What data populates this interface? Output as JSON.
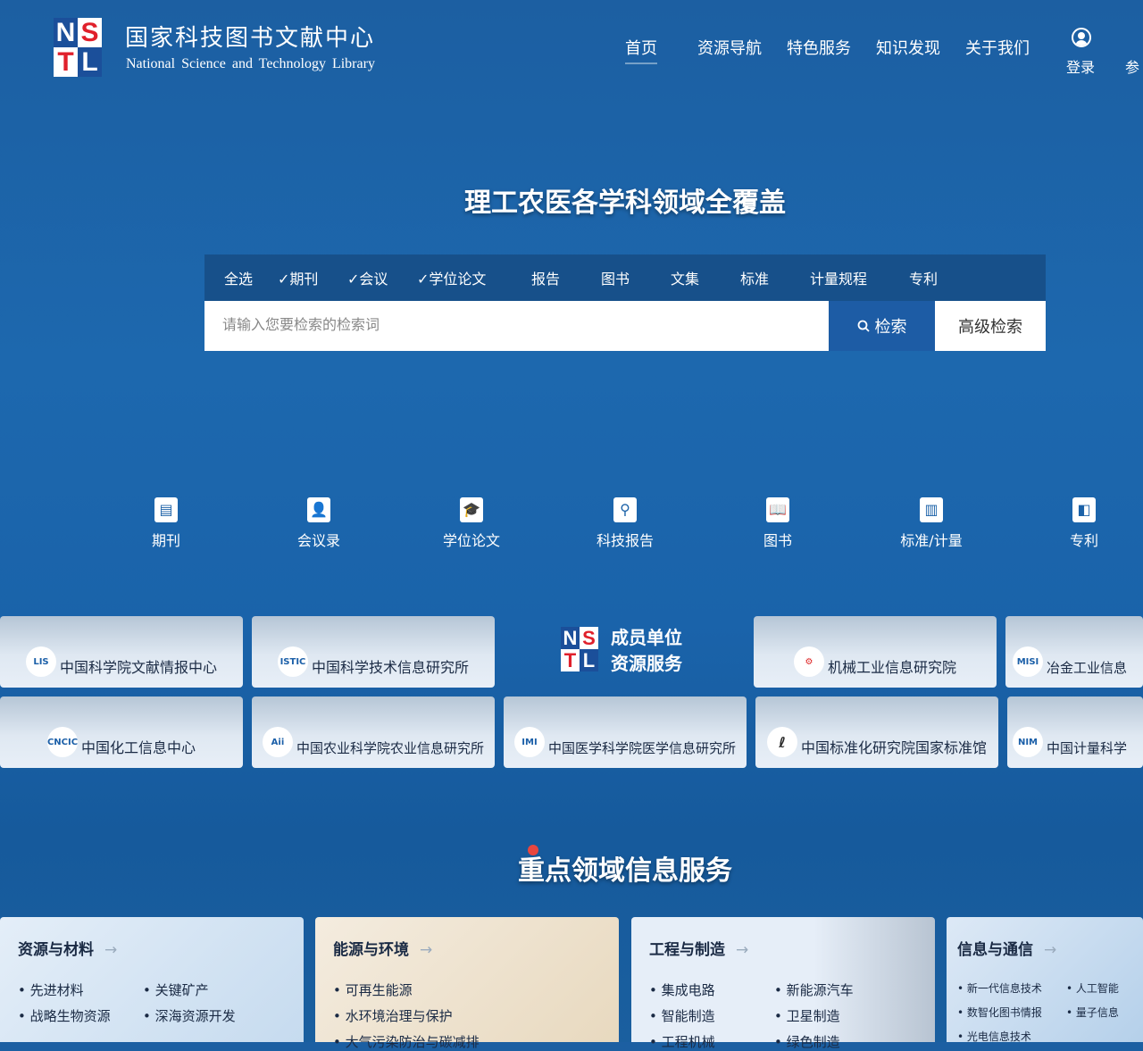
{
  "header": {
    "logo_letters": [
      "N",
      "S",
      "T",
      "L"
    ],
    "logo_cn": "国家科技图书文献中心",
    "logo_en": "National Science and Technology Library",
    "nav": [
      "首页",
      "资源导航",
      "特色服务",
      "知识发现",
      "关于我们"
    ],
    "login": "登录",
    "extra": "参"
  },
  "hero": {
    "title": "理工农医各学科领域全覆盖"
  },
  "search": {
    "filters": [
      "全选",
      "✓期刊",
      "✓会议",
      "✓学位论文",
      "报告",
      "图书",
      "文集",
      "标准",
      "计量规程",
      "专利"
    ],
    "placeholder": "请输入您要检索的检索词",
    "search_btn": "检索",
    "advanced_btn": "高级检索"
  },
  "categories": [
    {
      "label": "期刊",
      "icon": "journal-icon"
    },
    {
      "label": "会议录",
      "icon": "conference-icon"
    },
    {
      "label": "学位论文",
      "icon": "graduation-cap-icon"
    },
    {
      "label": "科技报告",
      "icon": "report-icon"
    },
    {
      "label": "图书",
      "icon": "book-icon"
    },
    {
      "label": "标准/计量",
      "icon": "chart-icon"
    },
    {
      "label": "专利",
      "icon": "patent-icon"
    }
  ],
  "members": {
    "center_title1": "成员单位",
    "center_title2": "资源服务",
    "row1": [
      "中国科学院文献情报中心",
      "中国科学技术信息研究所",
      "机械工业信息研究院",
      "冶金工业信息"
    ],
    "row2": [
      "中国化工信息中心",
      "中国农业科学院农业信息研究所",
      "中国医学科学院医学信息研究所",
      "中国标准化研究院国家标准馆",
      "中国计量科学"
    ]
  },
  "fields": {
    "title": "重点领域信息服务",
    "arrow": "→",
    "cards": [
      {
        "title": "资源与材料",
        "items": [
          "先进材料",
          "关键矿产",
          "战略生物资源",
          "深海资源开发"
        ]
      },
      {
        "title": "能源与环境",
        "items": [
          "可再生能源",
          "水环境治理与保护",
          "大气污染防治与碳减排"
        ]
      },
      {
        "title": "工程与制造",
        "items": [
          "集成电路",
          "新能源汽车",
          "智能制造",
          "卫星制造",
          "工程机械",
          "绿色制造"
        ]
      },
      {
        "title": "信息与通信",
        "items": [
          "新一代信息技术",
          "人工智能",
          "数智化图书情报",
          "量子信息",
          "光电信息技术"
        ]
      }
    ]
  }
}
